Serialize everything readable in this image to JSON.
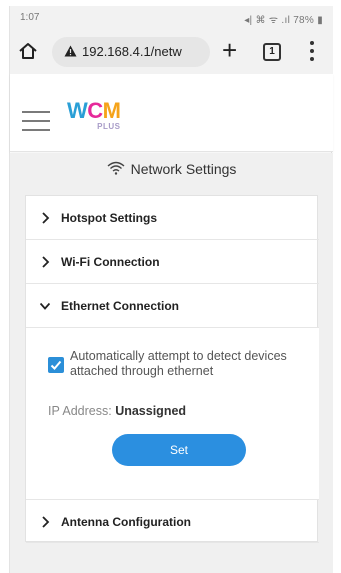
{
  "status_bar": {
    "time": "1:07",
    "indicators": "‡ ≡ .∥ 78%",
    "battery": "78%"
  },
  "browser": {
    "url": "192.168.4.1/netw",
    "tab_count": "1",
    "icons": [
      "home-icon",
      "warning-icon",
      "plus-icon",
      "tabs-icon",
      "more-icon"
    ]
  },
  "app": {
    "logo_main": [
      "W",
      "C",
      "M"
    ],
    "logo_sub": "PLUS",
    "brand_colors": {
      "w": "#2a9fd6",
      "c": "#e6299a",
      "m": "#f5a31a",
      "plus": "#a89cc8"
    }
  },
  "page": {
    "title": "Network Settings",
    "sections": [
      {
        "label": "Hotspot Settings",
        "expanded": false
      },
      {
        "label": "Wi-Fi Connection",
        "expanded": false
      },
      {
        "label": "Ethernet Connection",
        "expanded": true
      },
      {
        "label": "Antenna Configuration",
        "expanded": false
      }
    ],
    "ethernet": {
      "checkbox_label": "Automatically attempt to detect devices attached through ethernet",
      "checkbox_checked": true,
      "ip_label": "IP Address:",
      "ip_value": "Unassigned",
      "button_label": "Set"
    }
  },
  "colors": {
    "accent": "#2b8fe0",
    "page_bg": "#f0f0f0"
  }
}
